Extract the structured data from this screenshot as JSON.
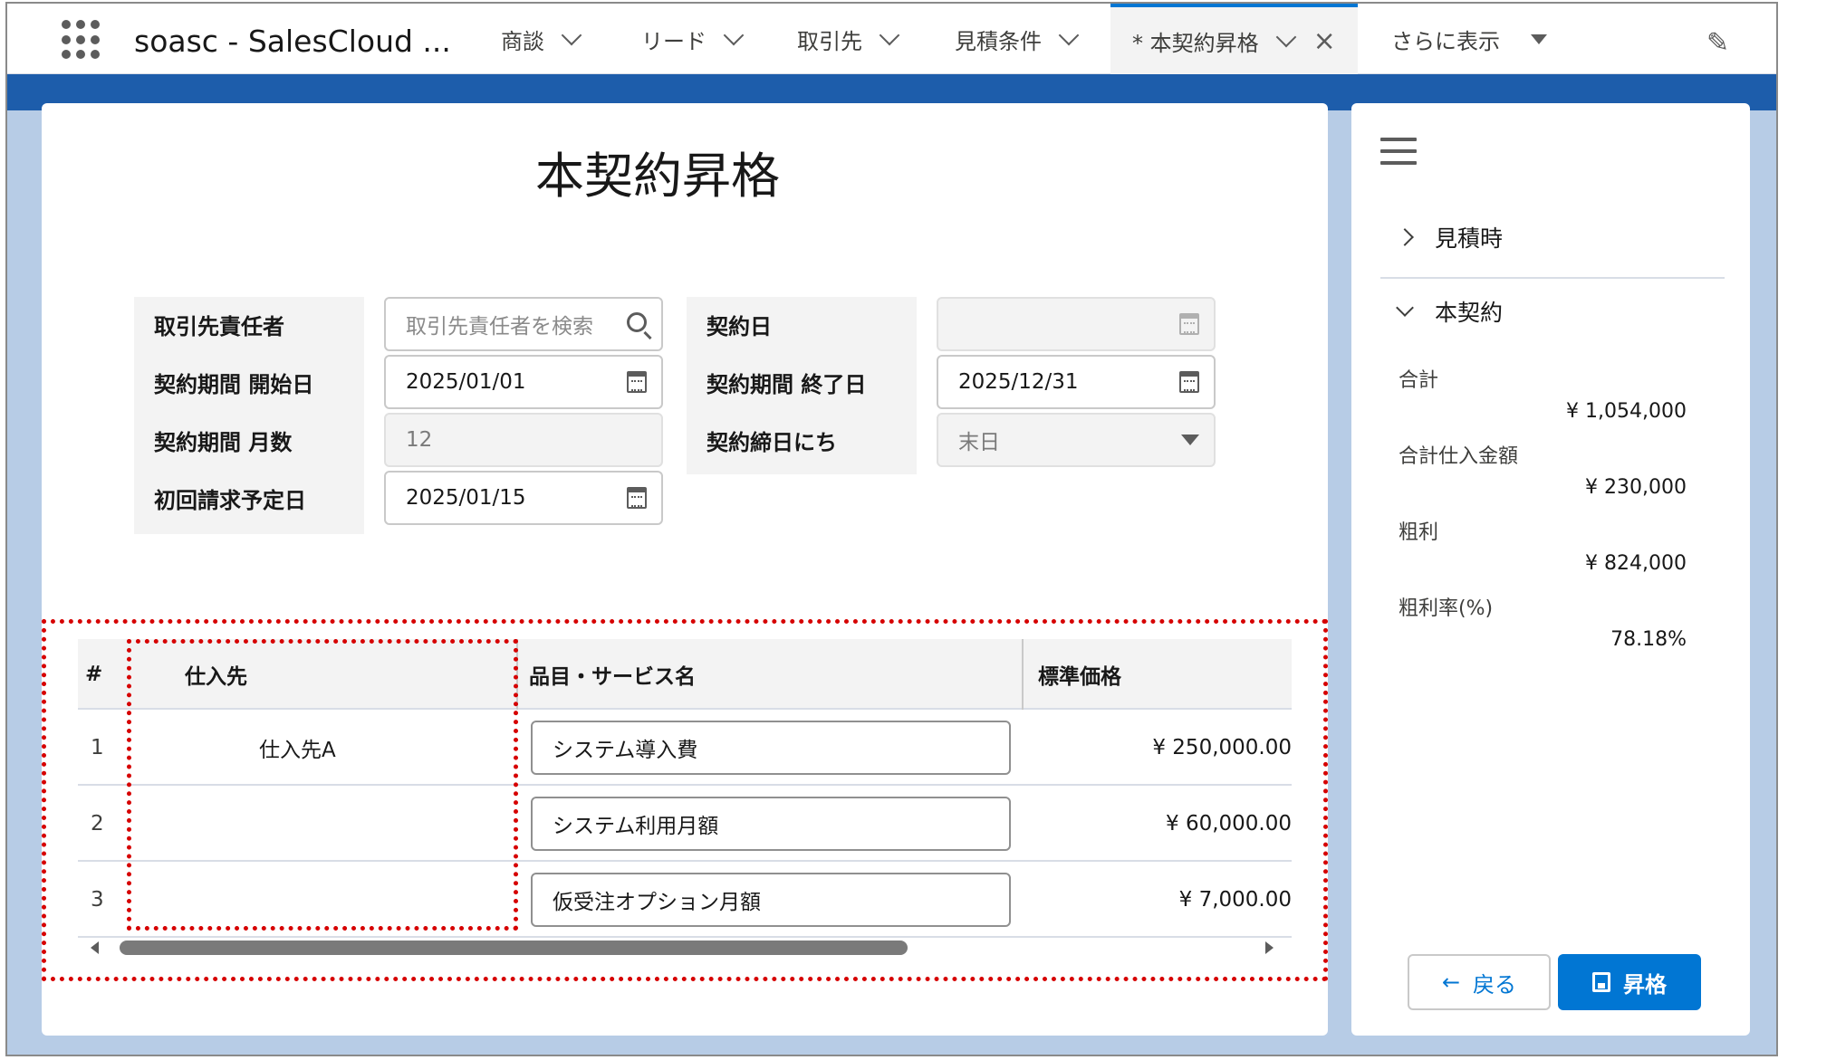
{
  "app": {
    "title": "soasc - SalesCloud ..."
  },
  "tabs": [
    {
      "label": "商談"
    },
    {
      "label": "リード"
    },
    {
      "label": "取引先"
    },
    {
      "label": "見積条件"
    },
    {
      "label": "* 本契約昇格",
      "active": true
    },
    {
      "label": "さらに表示"
    }
  ],
  "page": {
    "title": "本契約昇格"
  },
  "form": {
    "contact": {
      "label": "取引先責任者",
      "placeholder": "取引先責任者を検索"
    },
    "contract_date": {
      "label": "契約日",
      "value": ""
    },
    "start_date": {
      "label": "契約期間 開始日",
      "value": "2025/01/01"
    },
    "end_date": {
      "label": "契約期間 終了日",
      "value": "2025/12/31"
    },
    "months": {
      "label": "契約期間 月数",
      "value": "12"
    },
    "closing_day": {
      "label": "契約締日にち",
      "value": "末日"
    },
    "first_billing": {
      "label": "初回請求予定日",
      "value": "2025/01/15"
    }
  },
  "table": {
    "headers": {
      "num": "#",
      "supplier": "仕入先",
      "item": "品目・サービス名",
      "price": "標準価格"
    },
    "rows": [
      {
        "num": "1",
        "supplier": "仕入先A",
        "item": "システム導入費",
        "price": "¥ 250,000.00"
      },
      {
        "num": "2",
        "supplier": "",
        "item": "システム利用月額",
        "price": "¥ 60,000.00"
      },
      {
        "num": "3",
        "supplier": "",
        "item": "仮受注オプション月額",
        "price": "¥ 7,000.00"
      }
    ]
  },
  "side": {
    "sections": {
      "quote": "見積時",
      "contract": "本契約"
    },
    "summary": [
      {
        "label": "合計",
        "value": "¥ 1,054,000"
      },
      {
        "label": "合計仕入金額",
        "value": "¥ 230,000"
      },
      {
        "label": "粗利",
        "value": "¥ 824,000"
      },
      {
        "label": "粗利率(%)",
        "value": "78.18%"
      }
    ],
    "buttons": {
      "back": "戻る",
      "promote": "昇格"
    }
  },
  "colors": {
    "brand": "#0176d3",
    "highlight": "#d60000",
    "background": "#b7cce6"
  },
  "icons": [
    "app-launcher-icon",
    "chevron-down-icon",
    "close-icon",
    "pencil-icon",
    "search-icon",
    "calendar-icon",
    "menu-icon",
    "chevron-right-icon",
    "arrow-left-icon",
    "save-icon"
  ]
}
